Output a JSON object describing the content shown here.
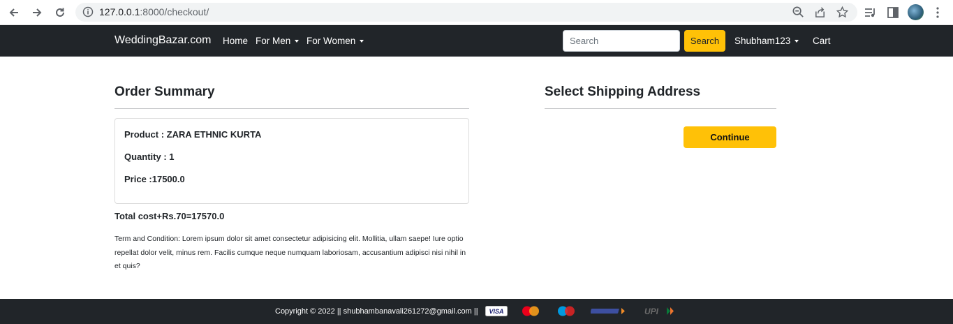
{
  "browser": {
    "url_host": "127.0.0.1",
    "url_rest": ":8000/checkout/"
  },
  "navbar": {
    "brand": "WeddingBazar.com",
    "links": [
      "Home",
      "For Men",
      "For Women"
    ],
    "search_placeholder": "Search",
    "search_button": "Search",
    "user": "Shubham123",
    "cart": "Cart"
  },
  "order_summary": {
    "title": "Order Summary",
    "product": "Product : ZARA ETHNIC KURTA",
    "quantity": "Quantity : 1",
    "price": "Price :17500.0",
    "total": "Total cost+Rs.70=17570.0",
    "terms": "Term and Condition: Lorem ipsum dolor sit amet consectetur adipisicing elit. Mollitia, ullam saepe! Iure optio repellat dolor velit, minus rem. Facilis cumque neque numquam laboriosam, accusantium adipisci nisi nihil in et quis?"
  },
  "shipping": {
    "title": "Select Shipping Address",
    "continue_button": "Continue"
  },
  "footer": {
    "copyright": "Copyright © 2022 || shubhambanavali261272@gmail.com ||",
    "payment_icons": [
      "visa-icon",
      "mastercard-icon",
      "maestro-icon",
      "rupay-icon",
      "upi-icon"
    ],
    "visa_text": "VISA",
    "upi_text": "UPI"
  },
  "colors": {
    "navbar": "#212529",
    "accent": "#ffc107"
  }
}
